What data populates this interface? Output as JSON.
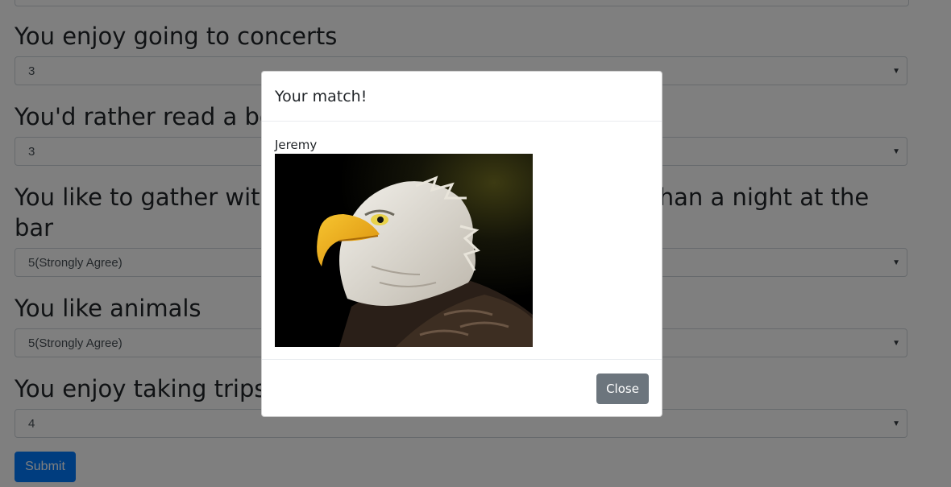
{
  "questions": [
    {
      "label": "You enjoy going to concerts",
      "value": "3"
    },
    {
      "label": "You'd rather read a book than watch a movie",
      "value": "3"
    },
    {
      "label": "You like to gather with friends for board games rather than a night at the bar",
      "value": "5(Strongly Agree)"
    },
    {
      "label": "You like animals",
      "value": "5(Strongly Agree)"
    },
    {
      "label": "You enjoy taking trips",
      "value": "4"
    }
  ],
  "submit_label": "Submit",
  "modal": {
    "title": "Your match!",
    "match_name": "Jeremy",
    "photo_subject": "bald-eagle-portrait",
    "close_label": "Close"
  },
  "colors": {
    "primary": "#007bff",
    "secondary": "#6c757d",
    "backdrop": "rgba(0,0,0,0.5)"
  }
}
